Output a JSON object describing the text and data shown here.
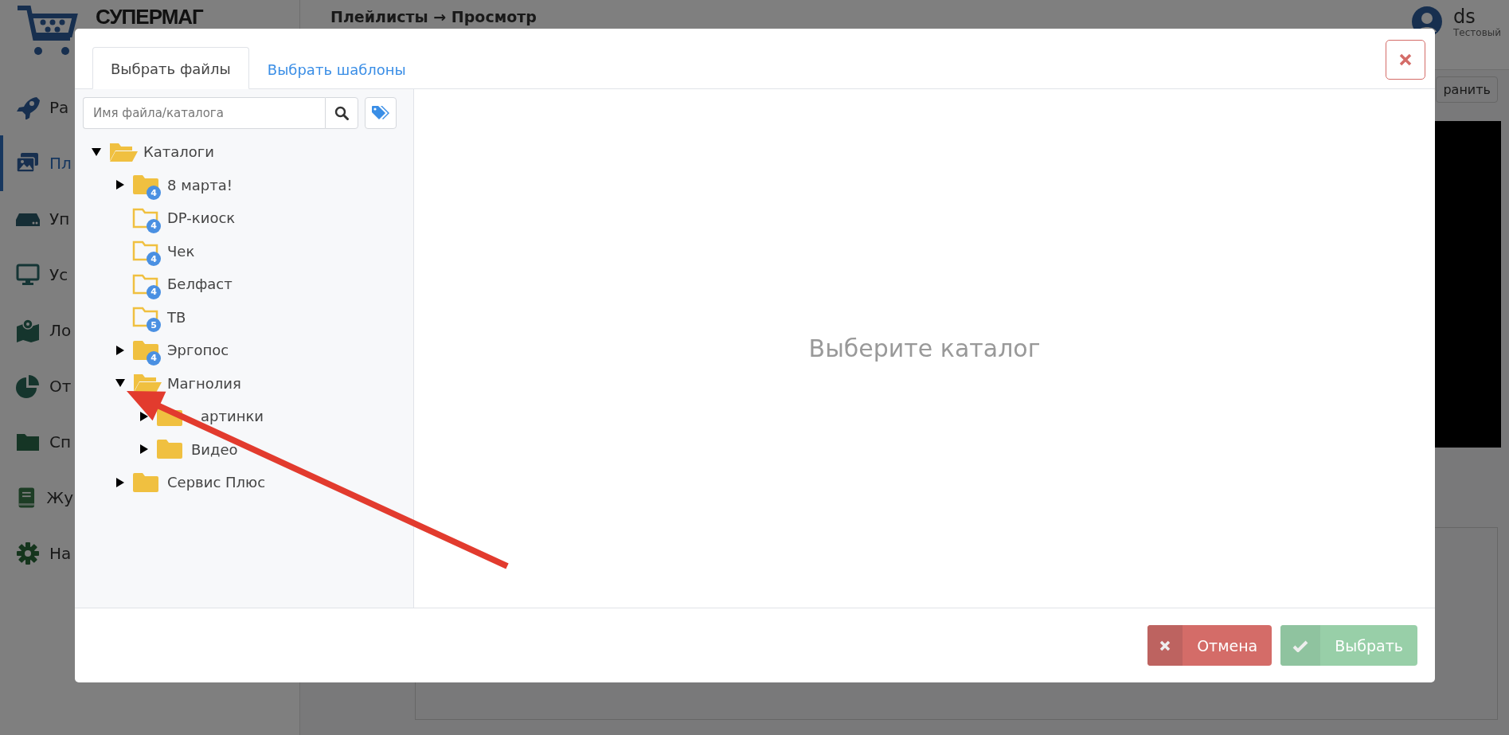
{
  "app": {
    "logo": "СУПЕРМАГ",
    "breadcrumb": "Плейлисты → Просмотр",
    "user": {
      "name": "ds",
      "role": "Тестовый"
    },
    "save_button": "ранить"
  },
  "sidebar": {
    "items": [
      {
        "label": "Ра",
        "selected": false
      },
      {
        "label": "Пл",
        "selected": true
      },
      {
        "label": "Уп",
        "selected": false
      },
      {
        "label": "Ус",
        "selected": false
      },
      {
        "label": "Ло",
        "selected": false
      },
      {
        "label": "От",
        "selected": false
      },
      {
        "label": "Сп",
        "selected": false
      },
      {
        "label": "Жу",
        "selected": false
      },
      {
        "label": "На",
        "selected": false
      }
    ]
  },
  "dialog": {
    "tabs": [
      {
        "label": "Выбрать файлы",
        "selected": true
      },
      {
        "label": "Выбрать шаблоны",
        "selected": false
      }
    ],
    "search": {
      "placeholder": "Имя файла/каталога"
    },
    "tree": [
      {
        "label": "Каталоги",
        "kind": "branch",
        "expanded": true,
        "children": [
          {
            "label": "8 марта!",
            "kind": "branch",
            "expanded": false,
            "count": "4"
          },
          {
            "label": "DP-киоск",
            "kind": "leaf",
            "count": "4"
          },
          {
            "label": "Чек",
            "kind": "leaf",
            "count": "4"
          },
          {
            "label": "Белфаст",
            "kind": "leaf",
            "count": "4"
          },
          {
            "label": "ТВ",
            "kind": "leaf",
            "count": "5"
          },
          {
            "label": "Эргопос",
            "kind": "branch",
            "expanded": false,
            "count": "4"
          },
          {
            "label": "Магнолия",
            "kind": "branch",
            "expanded": true,
            "children": [
              {
                "label": "артинки",
                "kind": "branch",
                "expanded": false
              },
              {
                "label": "Видео",
                "kind": "branch",
                "expanded": false
              }
            ]
          },
          {
            "label": "Сервис Плюс",
            "kind": "branch",
            "expanded": false
          }
        ]
      }
    ],
    "empty_message": "Выберите каталог",
    "buttons": [
      {
        "kind": "cancel",
        "label": "Отмена"
      },
      {
        "kind": "confirm",
        "label": "Выбрать"
      }
    ]
  }
}
